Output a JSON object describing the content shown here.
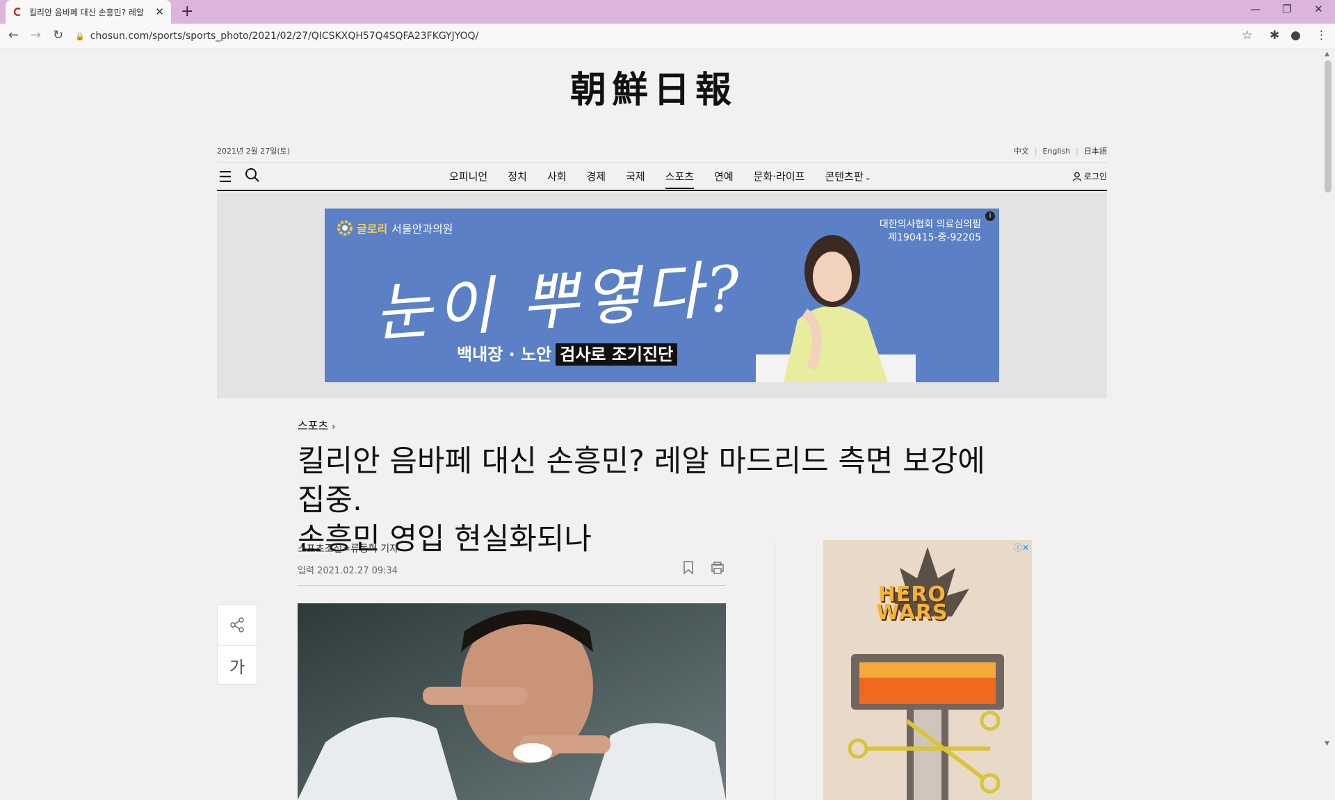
{
  "browser": {
    "tab_title": "킬리안 음바페 대신 손흥민? 레알",
    "url": "chosun.com/sports/sports_photo/2021/02/27/QICSKXQH57Q4SQFA23FKGYJYOQ/",
    "colors": {
      "tab_strip": "#dcb4dc"
    }
  },
  "site": {
    "logo": "朝鮮日報",
    "date": "2021년 2월 27일(토)",
    "languages": [
      "中文",
      "English",
      "日本語"
    ],
    "nav_items": [
      "오피니언",
      "정치",
      "사회",
      "경제",
      "국제",
      "스포츠",
      "연예",
      "문화·라이프",
      "콘텐츠판"
    ],
    "active_nav": "스포츠",
    "login": "로그인"
  },
  "banner_ad": {
    "brand_highlight": "글로리",
    "brand_rest": "서울안과의원",
    "headline": "눈이 뿌옇다?",
    "sub_left": "백내장 · 노안",
    "sub_box": "검사로 조기진단",
    "permit_line1": "대한의사협회 의료심의필",
    "permit_line2": "제190415-중-92205",
    "info": "i",
    "colors": {
      "background": "#5b80c6"
    }
  },
  "article": {
    "section": "스포츠",
    "headline_line1": "킬리안 음바페 대신 손흥민? 레알 마드리드 측면 보강에 집중.",
    "headline_line2": "손흥민 영입 현실화되나",
    "byline": "스포츠조선=류동혁 기자",
    "published": "입력 2021.02.27 09:34",
    "font_button": "가"
  },
  "side_ad": {
    "logo_line1": "HERO",
    "logo_line2": "WARS",
    "badge": "ⓘ✕"
  }
}
